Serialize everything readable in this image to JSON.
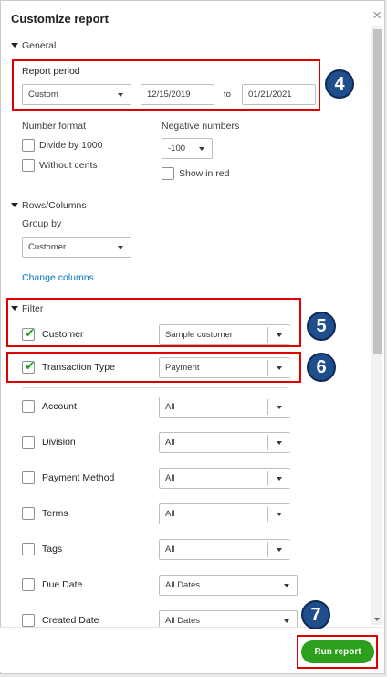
{
  "title": "Customize report",
  "general": {
    "section_label": "General",
    "report_period_label": "Report period",
    "period_select": "Custom",
    "start_date": "12/15/2019",
    "to_label": "to",
    "end_date": "01/21/2021",
    "number_format_label": "Number format",
    "divide_label": "Divide by 1000",
    "without_cents_label": "Without cents",
    "negative_label": "Negative numbers",
    "negative_select": "-100",
    "show_in_red_label": "Show in red"
  },
  "rows_columns": {
    "section_label": "Rows/Columns",
    "group_by_label": "Group by",
    "group_by_select": "Customer",
    "change_columns_link": "Change columns"
  },
  "filter": {
    "section_label": "Filter",
    "items": [
      {
        "label": "Customer",
        "value": "Sample customer",
        "checked": true
      },
      {
        "label": "Transaction Type",
        "value": "Payment",
        "checked": true
      },
      {
        "label": "Account",
        "value": "All",
        "checked": false
      },
      {
        "label": "Division",
        "value": "All",
        "checked": false
      },
      {
        "label": "Payment Method",
        "value": "All",
        "checked": false
      },
      {
        "label": "Terms",
        "value": "All",
        "checked": false
      },
      {
        "label": "Tags",
        "value": "All",
        "checked": false
      },
      {
        "label": "Due Date",
        "value": "All Dates",
        "checked": false
      },
      {
        "label": "Created Date",
        "value": "All Dates",
        "checked": false
      }
    ]
  },
  "annotations": {
    "badge_4": "4",
    "badge_5": "5",
    "badge_6": "6",
    "badge_7": "7",
    "highlight_color": "#e00000",
    "badge_color": "#1f4e8c"
  },
  "footer": {
    "run_report_label": "Run report",
    "accent_color": "#2ca01c"
  },
  "icons": {
    "close": "×",
    "checkmark": "✔"
  }
}
